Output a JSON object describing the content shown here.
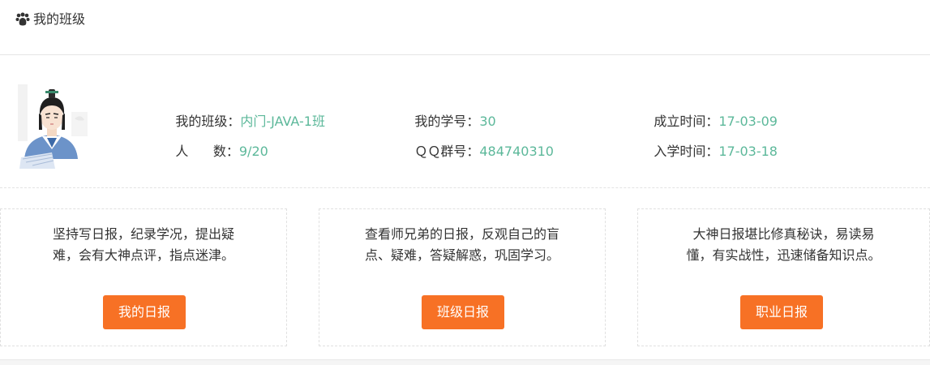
{
  "header": {
    "title": "我的班级",
    "icon": "users-icon"
  },
  "profile": {
    "avatar": "scholar-avatar",
    "class_label": "我的班级：",
    "class_value": "内门-JAVA-1班",
    "count_label": "人      数：",
    "count_value": "9/20",
    "student_id_label": "我的学号：",
    "student_id_value": "30",
    "qq_label": "ＱＱ群号：",
    "qq_value": "484740310",
    "founded_label": "成立时间：",
    "founded_value": "17-03-09",
    "enrolled_label": "入学时间：",
    "enrolled_value": "17-03-18"
  },
  "cards": [
    {
      "line1": "坚持写日报，纪录学况，提出疑",
      "line2": "难，会有大神点评，指点迷津。",
      "button": "我的日报"
    },
    {
      "line1": "查看师兄弟的日报，反观自己的盲",
      "line2": "点、疑难，答疑解惑，巩固学习。",
      "button": "班级日报"
    },
    {
      "line1": "大神日报堪比修真秘诀，易读易",
      "line2": "懂，有实战性，迅速储备知识点。",
      "button": "职业日报"
    }
  ],
  "colors": {
    "accent": "#5cb89a",
    "button": "#f77125"
  }
}
